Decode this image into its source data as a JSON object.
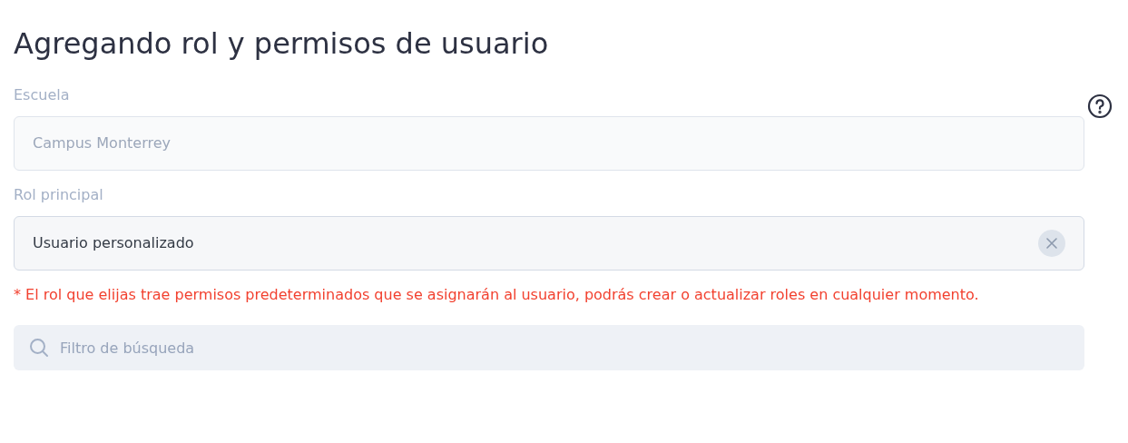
{
  "title": "Agregando rol y permisos de usuario",
  "fields": [
    {
      "label": "Escuela",
      "value": "Campus Monterrey",
      "disabled": true,
      "clearable": false
    },
    {
      "label": "Rol principal",
      "value": "Usuario personalizado",
      "disabled": false,
      "clearable": true
    }
  ],
  "note": "* El rol que elijas trae permisos predeterminados que se asignarán al usuario, podrás crear o actualizar roles en cualquier momento.",
  "search": {
    "placeholder": "Filtro de búsqueda"
  }
}
